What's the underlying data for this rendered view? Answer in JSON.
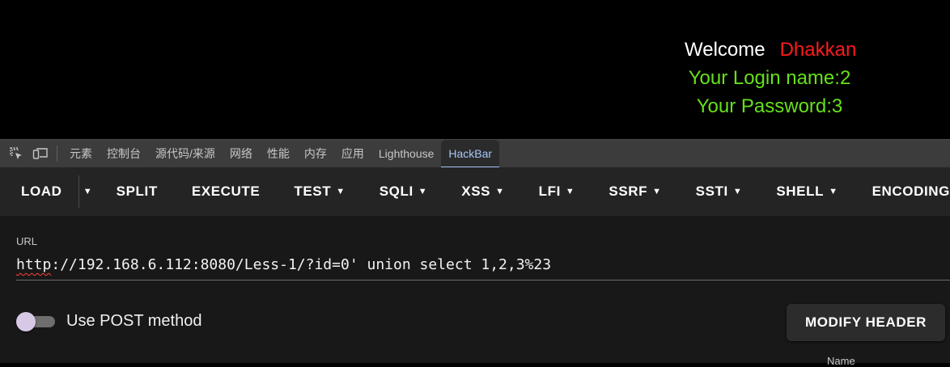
{
  "page": {
    "welcome_word": "Welcome",
    "welcome_name": "Dhakkan",
    "login_line": "Your Login name:2",
    "password_line": "Your Password:3"
  },
  "devtools": {
    "icons": [
      "inspect-element-icon",
      "device-toolbar-icon"
    ],
    "tabs": [
      "元素",
      "控制台",
      "源代码/来源",
      "网络",
      "性能",
      "内存",
      "应用",
      "Lighthouse",
      "HackBar"
    ],
    "active_tab": "HackBar"
  },
  "hackbar": {
    "toolbar": {
      "load": "LOAD",
      "split": "SPLIT",
      "execute": "EXECUTE",
      "test": "TEST",
      "sqli": "SQLI",
      "xss": "XSS",
      "lfi": "LFI",
      "ssrf": "SSRF",
      "ssti": "SSTI",
      "shell": "SHELL",
      "encoding": "ENCODING"
    },
    "url_label": "URL",
    "url_scheme": "http",
    "url_rest": "://192.168.6.112:8080/Less-1/?id=0' union select 1,2,3%23",
    "post_toggle_label": "Use POST method",
    "post_enabled": false,
    "modify_header": "MODIFY HEADER",
    "header_column": "Name"
  },
  "colors": {
    "welcome_name": "#ff1a1a",
    "info_text": "#66e01a",
    "active_tab": "#a8c7fa",
    "toggle_knob": "#d7c8e6"
  }
}
